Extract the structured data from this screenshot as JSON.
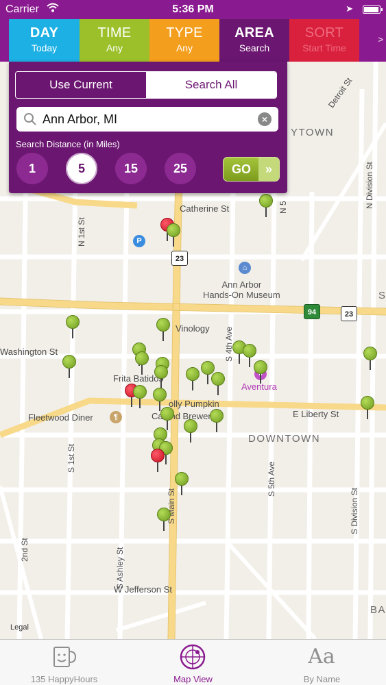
{
  "status_bar": {
    "carrier": "Carrier",
    "time": "5:36 PM",
    "battery_level": 1.0
  },
  "filters": {
    "day": {
      "title": "DAY",
      "value": "Today"
    },
    "time": {
      "title": "TIME",
      "value": "Any"
    },
    "type": {
      "title": "TYPE",
      "value": "Any"
    },
    "area": {
      "title": "AREA",
      "value": "Search"
    },
    "sort": {
      "title": "SORT",
      "value": "Start Time"
    },
    "more": ">"
  },
  "area_panel": {
    "use_current": "Use Current",
    "search_all": "Search All",
    "search_value": "Ann Arbor, MI",
    "distance_label": "Search Distance (in Miles)",
    "distances": [
      "1",
      "5",
      "15",
      "25"
    ],
    "selected_distance": "5",
    "go": "GO",
    "go_arrows": "»"
  },
  "map": {
    "labels": {
      "catherine": "Catherine St",
      "museum_1": "Ann Arbor",
      "museum_2": "Hands-On Museum",
      "vinology": "Vinology",
      "washington": "Washington St",
      "frita": "Frita Batidos",
      "aventura": "Aventura",
      "jolly": "olly Pumpkin",
      "cafe": "Ca     and Brewery",
      "fleetwood": "Fleetwood Diner",
      "liberty": "E Liberty St",
      "downtown": "DOWNTOWN",
      "town": "YTOWN",
      "jefferson": "W Jefferson St",
      "ba": "BA",
      "s_edge": "S",
      "legal": "Legal"
    },
    "vertical_labels": {
      "n1st": "N 1st St",
      "s1st": "S 1st St",
      "second": "2nd St",
      "ashley": "S Ashley St",
      "main": "S Main St",
      "fourth": "S 4th Ave",
      "fifth": "S 5th Ave",
      "division_s": "S Division St",
      "n5": "N 5",
      "division_n": "N Division St",
      "detroit": "Detroit St"
    },
    "shields": {
      "us23_a": "23",
      "us23_b": "23",
      "i94": "94"
    },
    "pin_colors": {
      "green": "#8bb63a",
      "red": "#e0182d"
    }
  },
  "tab_bar": {
    "happy_hours": "135 HappyHours",
    "map_view": "Map View",
    "by_name": "By Name",
    "by_name_icon_text": "Aa"
  },
  "colors": {
    "brand_purple": "#8a1a8f",
    "day_blue": "#1cb0e4",
    "time_green": "#9bc02a",
    "type_orange": "#f49e1d",
    "sort_red": "#d9203d"
  }
}
